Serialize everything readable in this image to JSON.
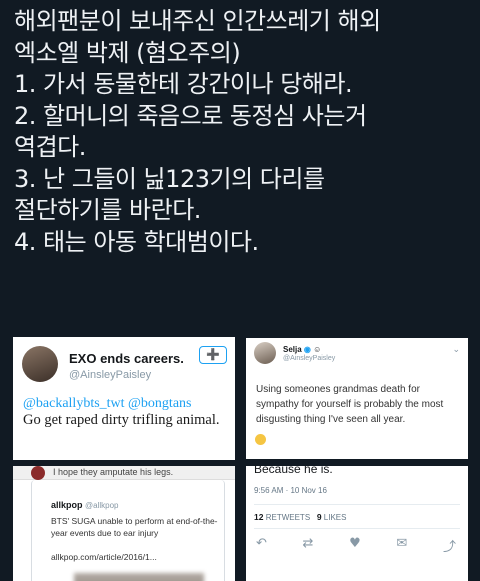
{
  "post": {
    "lines": [
      "해외팬분이 보내주신 인간쓰레기 해외",
      "엑소엘 박제 (혐오주의)",
      "1. 가서 동물한테 강간이나 당해라.",
      "2. 할머니의 죽음으로 동정심 사는거",
      "역겹다.",
      "3. 난 그들이 닖123기의 다리를",
      "절단하기를 바란다.",
      "4. 태는 아동 학대범이다."
    ]
  },
  "screenshot1": {
    "name": "EXO ends careers.",
    "handle": "@AinsleyPaisley",
    "follow_icon": "add-user-icon",
    "mentions": "@backallybts_twt @bongtans",
    "body": "Go get raped dirty trifling animal."
  },
  "screenshot2": {
    "name": "Selja",
    "handle": "@AinsleyPaisley",
    "body": "Using someones grandmas death for sympathy for yourself is probably the most disgusting thing I've seen all year.",
    "emoji_icon": "sweat-smile-emoji-icon"
  },
  "screenshot3": {
    "reply_text": "I hope they amputate his legs.",
    "quoted_source": "allkpop",
    "quoted_handle": "@allkpop",
    "quoted_body": "BTS' SUGA unable to perform at end-of-the-year events due to ear injury",
    "quoted_link": "allkpop.com/article/2016/1..."
  },
  "screenshot4": {
    "body": "Because he is.",
    "timestamp": "9:56 AM · 10 Nov 16",
    "retweets_count": "12",
    "retweets_label": "RETWEETS",
    "likes_count": "9",
    "likes_label": "LIKES",
    "actions": [
      "reply-icon",
      "retweet-icon",
      "like-icon",
      "dm-icon",
      "share-icon"
    ]
  },
  "colors": {
    "background": "#111a23",
    "text": "#eef1f4",
    "twitter_blue": "#1da1f2"
  }
}
